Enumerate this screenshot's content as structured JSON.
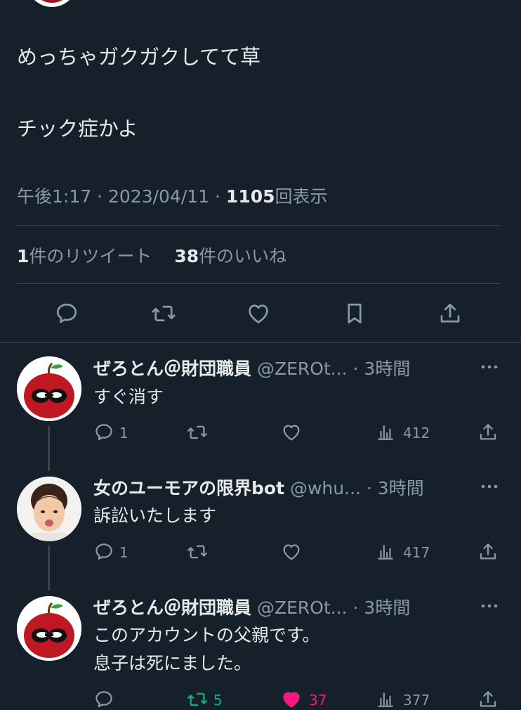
{
  "main_tweet": {
    "line1": "めっちゃガクガクしてて草",
    "line2": "チック症かよ",
    "time": "午後1:17 · 2023/04/11 · ",
    "views_count": "1105",
    "views_label": "回表示",
    "retweet_count": "1",
    "retweet_label": "件のリツイート",
    "like_count": "38",
    "like_label": "件のいいね"
  },
  "replies": [
    {
      "name": "ぜろとん＠財団職員",
      "handle": "@ZEROt... · 3時間",
      "line1": "すぐ消す",
      "line2": "",
      "reply_count": "1",
      "retweet_count": "",
      "like_count": "",
      "views": "412"
    },
    {
      "name": "女のユーモアの限界bot",
      "handle": "@whu... · 3時間",
      "line1": "訴訟いたします",
      "line2": "",
      "reply_count": "1",
      "retweet_count": "",
      "like_count": "",
      "views": "417"
    },
    {
      "name": "ぜろとん＠財団職員",
      "handle": "@ZEROt... · 3時間",
      "line1": "このアカウントの父親です。",
      "line2": "息子は死にました。",
      "reply_count": "",
      "retweet_count": "5",
      "like_count": "37",
      "views": "377"
    }
  ],
  "colors": {
    "background": "#15202b",
    "text": "#e7e9ea",
    "muted": "#8b98a5",
    "divider": "#38444d",
    "retweet_active": "#00ba7c",
    "like_active": "#f91880"
  },
  "icons": [
    "comment-icon",
    "retweet-icon",
    "heart-icon",
    "bookmark-icon",
    "share-icon",
    "more-icon",
    "views-icon"
  ]
}
